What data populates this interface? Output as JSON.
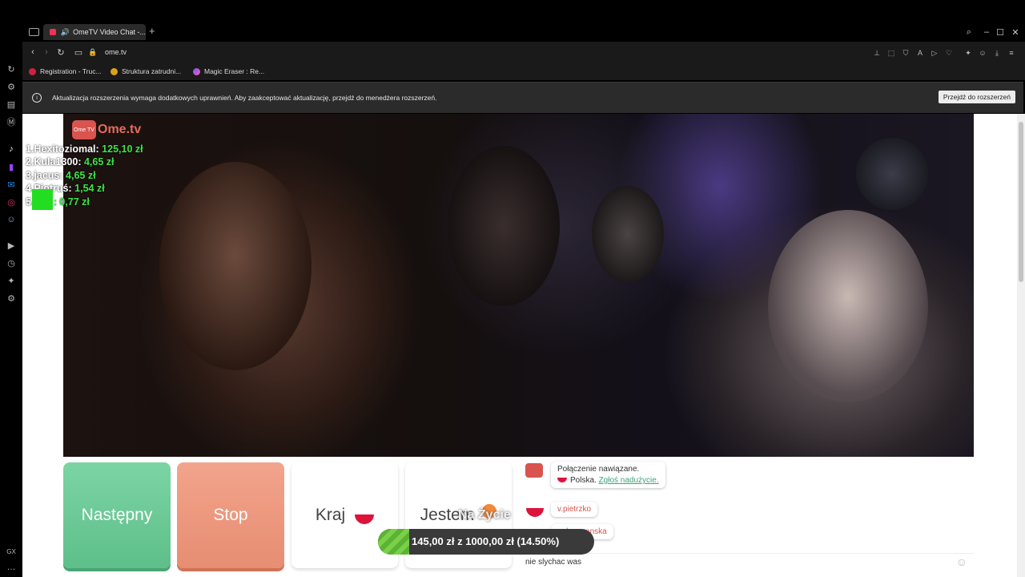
{
  "browser": {
    "tab_title": "OmeTV Video Chat -...",
    "url": "ome.tv",
    "bookmarks": [
      "Registration - Truc...",
      "Struktura zatrudni...",
      "Magic Eraser : Re..."
    ],
    "gx_label": "GX"
  },
  "notification": {
    "text": "Aktualizacja rozszerzenia wymaga dodatkowych uprawnień. Aby zaakceptować aktualizację, przejdź do menedżera rozszerzeń.",
    "button": "Przejdź do rozszerzeń"
  },
  "stream_overlay": {
    "logo_tv": "Ome TV",
    "logo_name": "Ome.tv",
    "leaderboard": [
      {
        "name": "1.Hexitoziomal:",
        "amount": "125,10 zł"
      },
      {
        "name": "2.Kula1300:",
        "amount": "4,65 zł"
      },
      {
        "name": "3.jacus:",
        "amount": "4,65 zł"
      },
      {
        "name": "4.Piotruś:",
        "amount": "1,54 zł"
      },
      {
        "name": "5.",
        "amount": ": 0,77 zł"
      }
    ],
    "progress_text": "145,00 zł z 1000,00 zł (14.50%)",
    "progress_fraction": 0.145,
    "goal_label": "Na Życie"
  },
  "controls": {
    "next": "Następny",
    "stop": "Stop",
    "country": "Kraj",
    "gender": "Jestem"
  },
  "chat": {
    "status_line1": "Połączenie nawiązane.",
    "status_country": "Polska.",
    "report_link": "Zgłoś nadużycie.",
    "messages": [
      "v.pietrzko",
      "nela_wronska"
    ],
    "input_value": "nie slychac was"
  }
}
